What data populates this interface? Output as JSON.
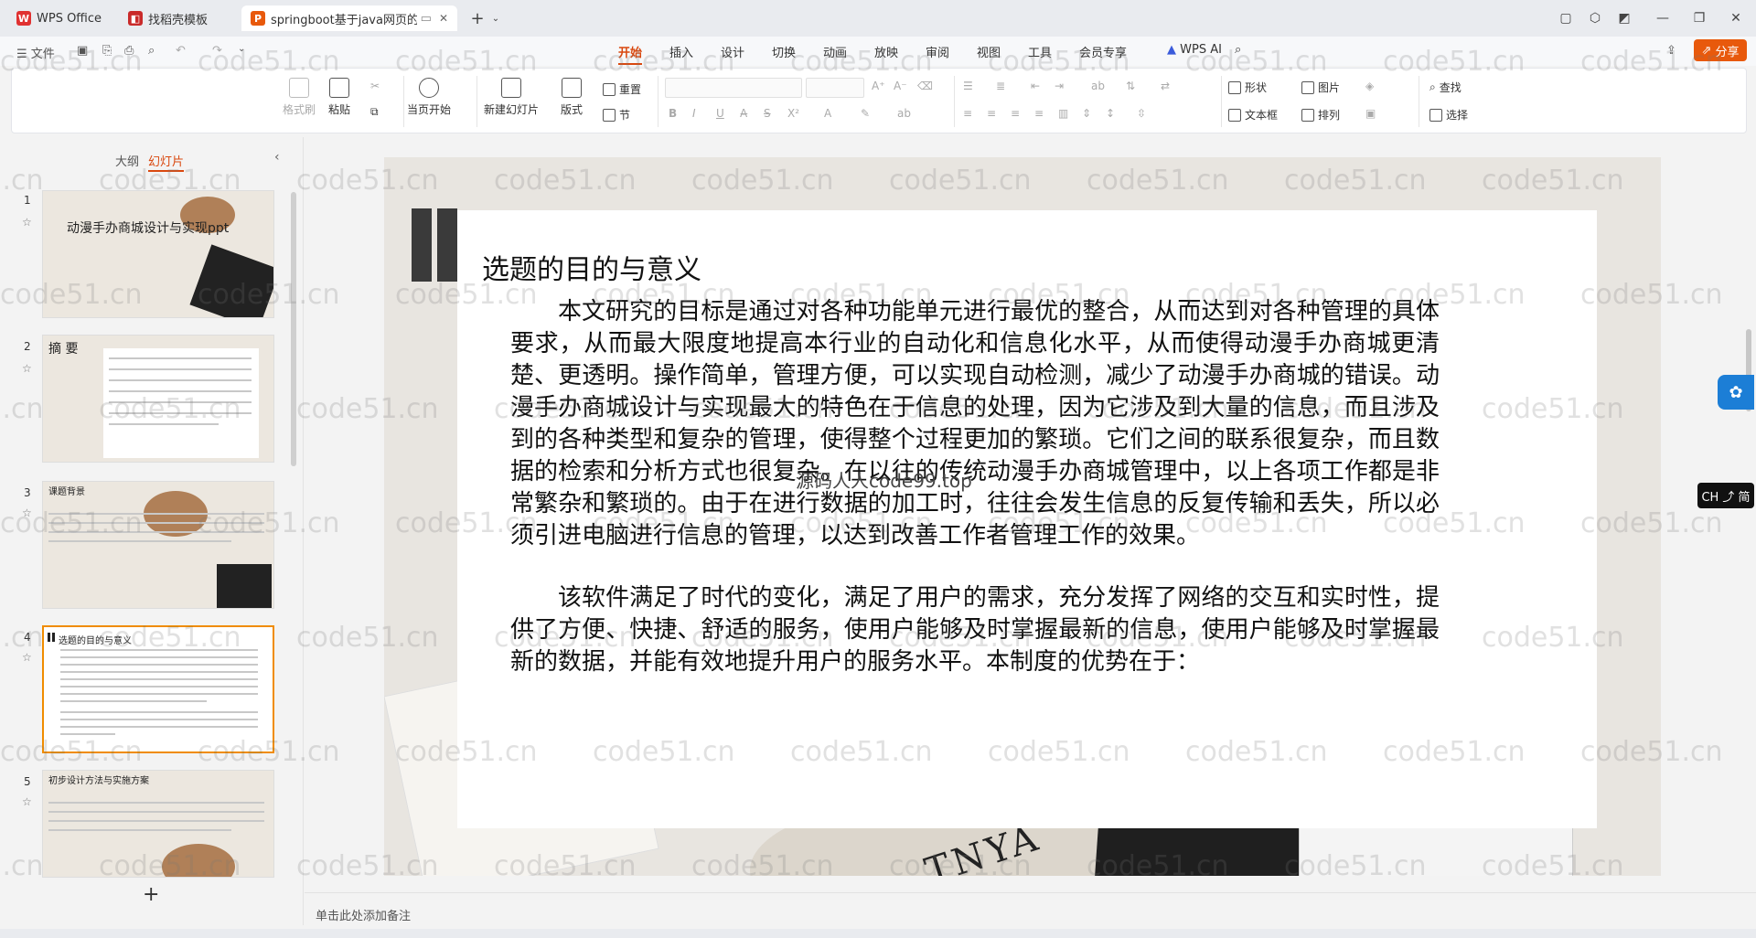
{
  "tabs": [
    {
      "label": "WPS Office",
      "icon": "wps-logo-icon"
    },
    {
      "label": "找稻壳模板",
      "icon": "docer-icon"
    },
    {
      "label": "springboot基于java网页的",
      "icon": "ppt-file-icon"
    }
  ],
  "menu": {
    "file": "文件",
    "items": [
      "开始",
      "插入",
      "设计",
      "切换",
      "动画",
      "放映",
      "审阅",
      "视图",
      "工具",
      "会员专享"
    ],
    "active": "开始",
    "wps_ai": "WPS AI",
    "share": "分享"
  },
  "ribbon": {
    "format_painter": "格式刷",
    "paste": "粘贴",
    "start_from": "当页开始",
    "new_slide": "新建幻灯片",
    "layout": "版式",
    "reset": "重置",
    "section": "节",
    "shape": "形状",
    "picture": "图片",
    "textbox": "文本框",
    "arrange": "排列",
    "find": "查找",
    "select": "选择"
  },
  "left_panel": {
    "tab_outline": "大纲",
    "tab_slides": "幻灯片",
    "slides": [
      {
        "num": "1",
        "title": "动漫手办商城设计与实现ppt"
      },
      {
        "num": "2",
        "title": "摘    要"
      },
      {
        "num": "3",
        "title": "课题背景"
      },
      {
        "num": "4",
        "title": "选题的目的与意义"
      },
      {
        "num": "5",
        "title": "初步设计方法与实施方案"
      }
    ],
    "add": "+"
  },
  "slide": {
    "title": "选题的目的与意义",
    "para1": "本文研究的目标是通过对各种功能单元进行最优的整合，从而达到对各种管理的具体要求，从而最大限度地提高本行业的自动化和信息化水平，从而使得动漫手办商城更清楚、更透明。操作简单，管理方便，可以实现自动检测，减少了动漫手办商城的错误。动漫手办商城设计与实现最大的特色在于信息的处理，因为它涉及到大量的信息，而且涉及到的各种类型和复杂的管理，使得整个过程更加的繁琐。它们之间的联系很复杂，而且数据的检索和分析方式也很复杂。在以往的传统动漫手办商城管理中，以上各项工作都是非常繁杂和繁琐的。由于在进行数据的加工时，往往会发生信息的反复传输和丢失，所以必须引进电脑进行信息的管理，以达到改善工作者管理工作的效果。",
    "para2": "该软件满足了时代的变化，满足了用户的需求，充分发挥了网络的交互和实时性，提供了方便、快捷、舒适的服务，使用户能够及时掌握最新的信息，使用户能够及时掌握最新的数据，并能有效地提升用户的服务水平。本制度的优势在于：",
    "overlay_text": "源码人人code99.top",
    "bg_text": "TNYA"
  },
  "notes_placeholder": "单击此处添加备注",
  "ime": "CH ⤴ 简",
  "watermark": "code51.cn",
  "colors": {
    "accent": "#d9480f",
    "share": "#e8590c",
    "ai_float": "#1c7ed6"
  }
}
